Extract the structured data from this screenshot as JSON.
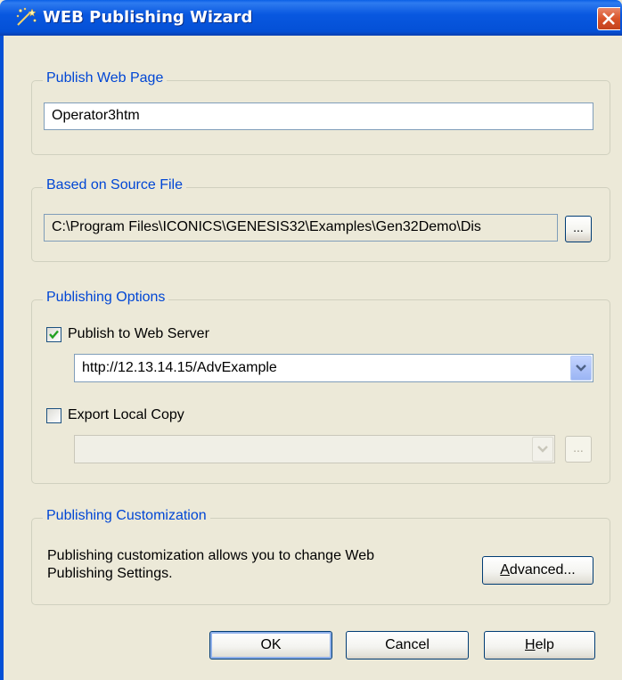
{
  "window": {
    "title": "WEB Publishing Wizard",
    "accent": "#0450d6",
    "legend_color": "#0046d5",
    "face_color": "#ece9d8"
  },
  "publish_web_page": {
    "legend": "Publish Web Page",
    "value": "Operator3htm"
  },
  "source_file": {
    "legend": "Based on Source File",
    "value": "C:\\Program Files\\ICONICS\\GENESIS32\\Examples\\Gen32Demo\\Dis",
    "browse_label": "..."
  },
  "publishing_options": {
    "legend": "Publishing Options",
    "publish_to_server_label": "Publish to Web Server",
    "publish_to_server_checked": true,
    "server_url": "http://12.13.14.15/AdvExample",
    "export_local_label": "Export Local Copy",
    "export_local_checked": false,
    "local_path": "",
    "local_browse_label": "..."
  },
  "customization": {
    "legend": "Publishing Customization",
    "description_line1": "Publishing customization allows you  to change Web",
    "description_line2": "Publishing Settings.",
    "advanced_prefix": "A",
    "advanced_rest": "dvanced..."
  },
  "buttons": {
    "ok": "OK",
    "cancel": "Cancel",
    "help_prefix": "H",
    "help_rest": "elp"
  }
}
